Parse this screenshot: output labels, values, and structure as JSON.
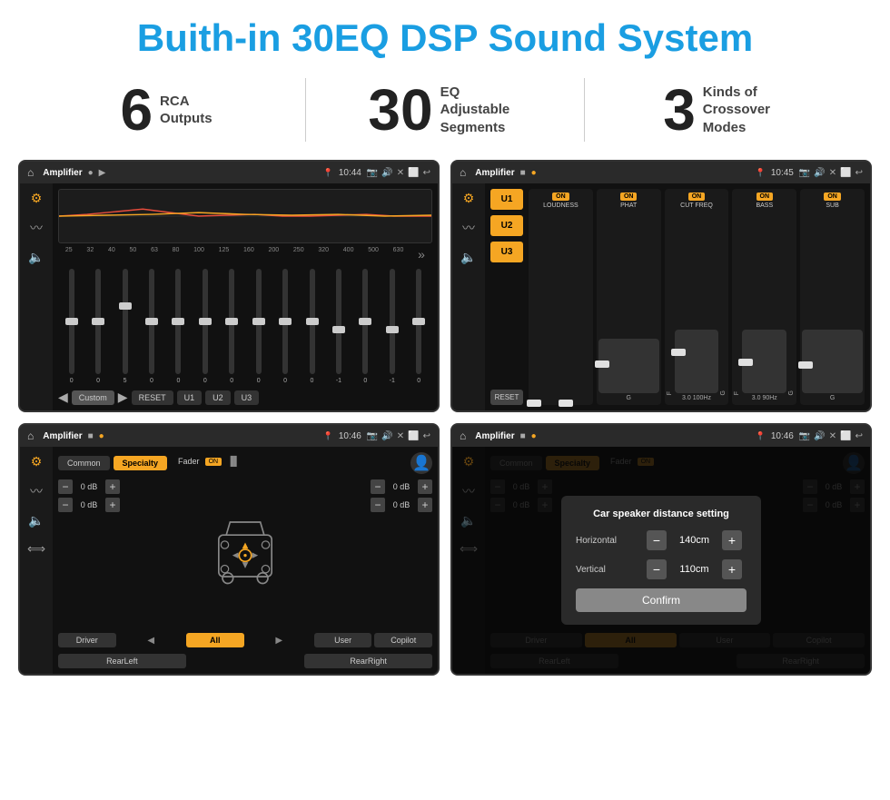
{
  "header": {
    "title": "Buith-in 30EQ DSP Sound System"
  },
  "stats": [
    {
      "number": "6",
      "text": "RCA\nOutputs"
    },
    {
      "number": "30",
      "text": "EQ Adjustable\nSegments"
    },
    {
      "number": "3",
      "text": "Kinds of\nCrossover Modes"
    }
  ],
  "screens": [
    {
      "id": "screen1",
      "topbar": {
        "title": "Amplifier",
        "time": "10:44"
      },
      "type": "eq"
    },
    {
      "id": "screen2",
      "topbar": {
        "title": "Amplifier",
        "time": "10:45"
      },
      "type": "amp"
    },
    {
      "id": "screen3",
      "topbar": {
        "title": "Amplifier",
        "time": "10:46"
      },
      "type": "specialty"
    },
    {
      "id": "screen4",
      "topbar": {
        "title": "Amplifier",
        "time": "10:46"
      },
      "type": "specialty-dialog",
      "dialog": {
        "title": "Car speaker distance setting",
        "horizontal_label": "Horizontal",
        "horizontal_value": "140cm",
        "vertical_label": "Vertical",
        "vertical_value": "110cm",
        "confirm_label": "Confirm"
      }
    }
  ],
  "eq": {
    "frequencies": [
      "25",
      "32",
      "40",
      "50",
      "63",
      "80",
      "100",
      "125",
      "160",
      "200",
      "250",
      "320",
      "400",
      "500",
      "630"
    ],
    "values": [
      "0",
      "0",
      "0",
      "5",
      "0",
      "0",
      "0",
      "0",
      "0",
      "0",
      "0",
      "-1",
      "0",
      "-1",
      "0"
    ],
    "presets": [
      "Custom",
      "RESET",
      "U1",
      "U2",
      "U3"
    ]
  },
  "amp": {
    "presets": [
      "U1",
      "U2",
      "U3"
    ],
    "controls": [
      {
        "label": "LOUDNESS",
        "on": true
      },
      {
        "label": "PHAT",
        "on": true
      },
      {
        "label": "CUT FREQ",
        "on": true
      },
      {
        "label": "BASS",
        "on": true
      },
      {
        "label": "SUB",
        "on": true
      }
    ]
  },
  "specialty": {
    "tabs": [
      "Common",
      "Specialty"
    ],
    "fader_label": "Fader",
    "db_values": [
      "0 dB",
      "0 dB",
      "0 dB",
      "0 dB"
    ],
    "bottom_btns": [
      "Driver",
      "All",
      "User",
      "RearLeft",
      "Copilot",
      "RearRight"
    ]
  },
  "dialog": {
    "title": "Car speaker distance setting",
    "horizontal_label": "Horizontal",
    "horizontal_value": "140cm",
    "vertical_label": "Vertical",
    "vertical_value": "110cm",
    "confirm_label": "Confirm"
  }
}
